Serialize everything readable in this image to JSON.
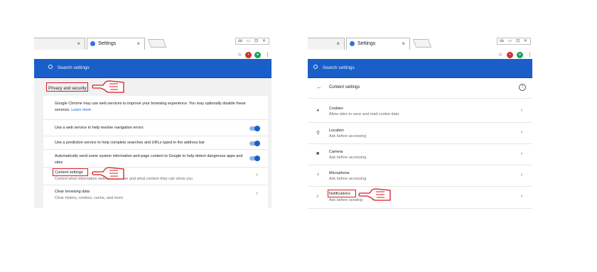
{
  "left": {
    "tabs": {
      "inactive_label": "",
      "active_label": "Settings",
      "close": "×"
    },
    "window_buttons": [
      "ꝏ",
      "▭",
      "⊡",
      "✕"
    ],
    "search_placeholder": "Search settings",
    "section_title": "Privacy and security",
    "intro": "Google Chrome may use web services to improve your browsing experience. You may optionally disable these services.",
    "learn_more": "Learn more",
    "settings": [
      {
        "label": "Use a web service to help resolve navigation errors",
        "toggle": true
      },
      {
        "label": "Use a prediction service to help complete searches and URLs typed in the address bar",
        "toggle": true
      },
      {
        "label": "Automatically send some system information and page content to Google to help detect dangerous apps and sites",
        "toggle": true
      }
    ],
    "content_settings": {
      "label": "Content settings",
      "sub": "Control what information websites can use and what content they can show you"
    },
    "clear_browsing": {
      "label": "Clear browsing data",
      "sub": "Clear history, cookies, cache, and more"
    }
  },
  "right": {
    "tabs": {
      "inactive_label": "",
      "active_label": "Settings",
      "close": "×"
    },
    "search_placeholder": "Search settings",
    "back": "←",
    "page_title": "Content settings",
    "help": "?",
    "items": [
      {
        "icon": "cookie-icon",
        "label": "Cookies",
        "sub": "Allow sites to save and read cookie data"
      },
      {
        "icon": "location-icon",
        "label": "Location",
        "sub": "Ask before accessing"
      },
      {
        "icon": "camera-icon",
        "label": "Camera",
        "sub": "Ask before accessing"
      },
      {
        "icon": "microphone-icon",
        "label": "Microphone",
        "sub": "Ask before accessing"
      },
      {
        "icon": "bell-icon",
        "label": "Notifications",
        "sub": "Ask before sending"
      }
    ]
  },
  "chevron": "›",
  "colors": {
    "accent": "#1a5fc9",
    "highlight": "#d31f26"
  }
}
